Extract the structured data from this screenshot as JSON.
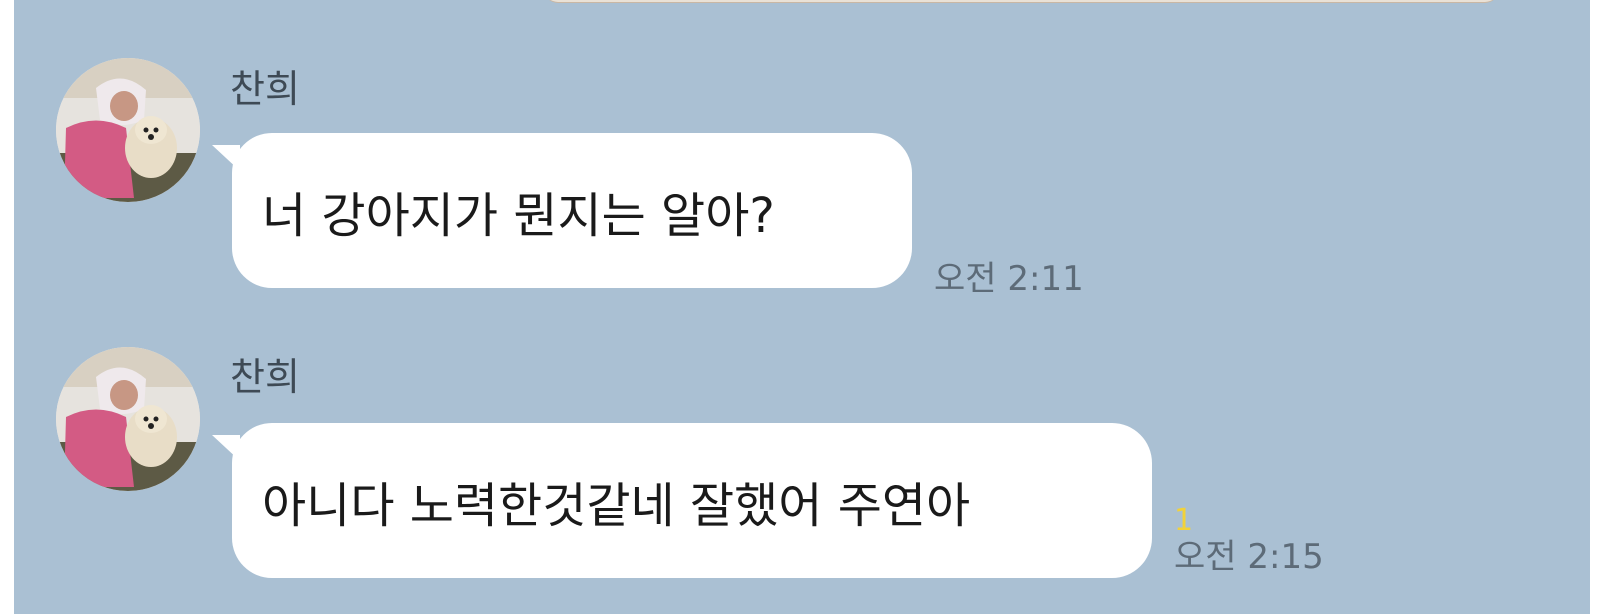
{
  "messages": [
    {
      "sender": "찬희",
      "text": "너 강아지가 뭔지는 알아?",
      "time": "오전 2:11",
      "unread": ""
    },
    {
      "sender": "찬희",
      "text": "아니다 노력한것같네 잘했어 주연아",
      "time": "오전 2:15",
      "unread": "1"
    }
  ],
  "colors": {
    "chat_background": "#aac0d3",
    "bubble": "#ffffff",
    "unread_count": "#f2d23a"
  }
}
